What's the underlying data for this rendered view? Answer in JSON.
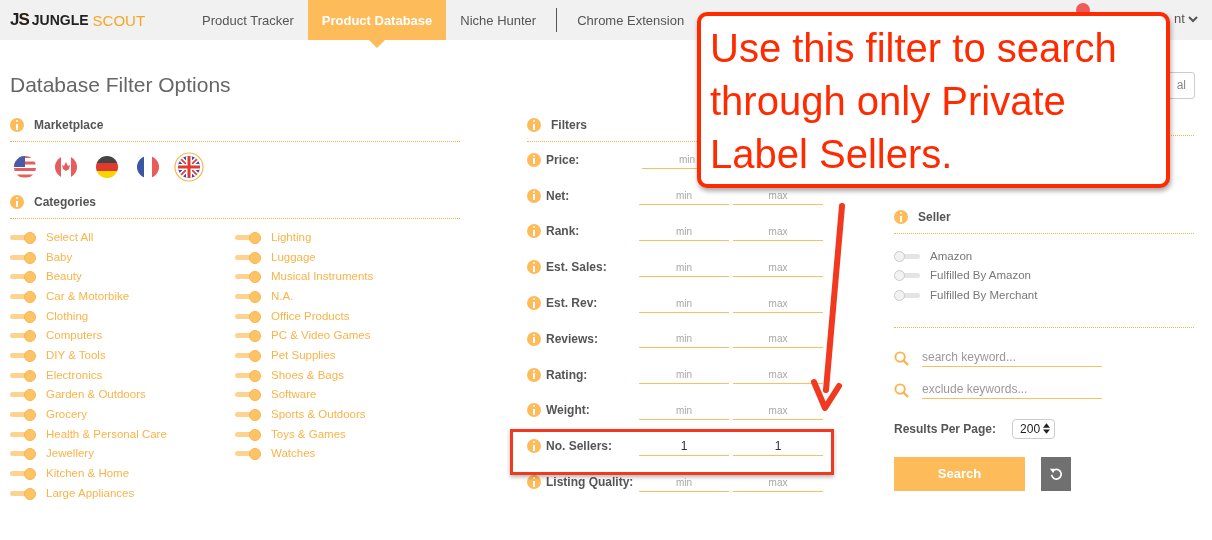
{
  "header": {
    "logo_mark": "JS",
    "logo_word_1": "JUNGLE",
    "logo_word_2": "SCOUT",
    "nav": [
      {
        "label": "Product Tracker",
        "selected": false
      },
      {
        "label": "Product Database",
        "selected": true
      },
      {
        "label": "Niche Hunter",
        "selected": false
      },
      {
        "label": "Chrome Extension",
        "selected": false
      }
    ],
    "account_partial": "nt"
  },
  "title": "Database Filter Options",
  "top_button_partial": "al",
  "marketplace": {
    "title": "Marketplace",
    "flags": [
      {
        "kind": "us",
        "selected": false
      },
      {
        "kind": "ca",
        "selected": false
      },
      {
        "kind": "de",
        "selected": false
      },
      {
        "kind": "fr",
        "selected": false
      },
      {
        "kind": "gb",
        "selected": true
      }
    ]
  },
  "categories": {
    "title": "Categories",
    "items": [
      {
        "label": "Select All",
        "on": true
      },
      {
        "label": "Baby",
        "on": true
      },
      {
        "label": "Beauty",
        "on": true
      },
      {
        "label": "Car & Motorbike",
        "on": true
      },
      {
        "label": "Clothing",
        "on": true
      },
      {
        "label": "Computers",
        "on": true
      },
      {
        "label": "DIY & Tools",
        "on": true
      },
      {
        "label": "Electronics",
        "on": true
      },
      {
        "label": "Garden & Outdoors",
        "on": true
      },
      {
        "label": "Grocery",
        "on": true
      },
      {
        "label": "Health & Personal Care",
        "on": true
      },
      {
        "label": "Jewellery",
        "on": true
      },
      {
        "label": "Kitchen & Home",
        "on": true
      },
      {
        "label": "Large Appliances",
        "on": true
      },
      {
        "label": "Lighting",
        "on": true
      },
      {
        "label": "Luggage",
        "on": true
      },
      {
        "label": "Musical Instruments",
        "on": true
      },
      {
        "label": "N.A.",
        "on": true
      },
      {
        "label": "Office Products",
        "on": true
      },
      {
        "label": "PC & Video Games",
        "on": true
      },
      {
        "label": "Pet Supplies",
        "on": true
      },
      {
        "label": "Shoes & Bags",
        "on": true
      },
      {
        "label": "Software",
        "on": true
      },
      {
        "label": "Sports & Outdoors",
        "on": true
      },
      {
        "label": "Toys & Games",
        "on": true
      },
      {
        "label": "Watches",
        "on": true
      }
    ]
  },
  "filters": {
    "title": "Filters",
    "rows": [
      {
        "label": "Price:",
        "min": {
          "placeholder": "min"
        }
      },
      {
        "label": "Net:",
        "min": {
          "placeholder": "min"
        },
        "max": {
          "placeholder": "max"
        }
      },
      {
        "label": "Rank:",
        "min": {
          "placeholder": "min"
        },
        "max": {
          "placeholder": "max"
        }
      },
      {
        "label": "Est. Sales:",
        "min": {
          "placeholder": "min"
        },
        "max": {
          "placeholder": "max"
        }
      },
      {
        "label": "Est. Rev:",
        "min": {
          "placeholder": "min"
        },
        "max": {
          "placeholder": "max"
        }
      },
      {
        "label": "Reviews:",
        "min": {
          "placeholder": "min"
        },
        "max": {
          "placeholder": "max"
        }
      },
      {
        "label": "Rating:",
        "min": {
          "placeholder": "min"
        },
        "max": {
          "placeholder": "max"
        }
      },
      {
        "label": "Weight:",
        "min": {
          "placeholder": "min"
        },
        "max": {
          "placeholder": "max"
        }
      },
      {
        "label": "No. Sellers:",
        "min": {
          "value": "1"
        },
        "max": {
          "value": "1"
        }
      },
      {
        "label": "Listing Quality:",
        "min": {
          "placeholder": "min"
        },
        "max": {
          "placeholder": "max"
        }
      }
    ]
  },
  "seller": {
    "title": "Seller",
    "options": [
      {
        "label": "Amazon",
        "on": false
      },
      {
        "label": "Fulfilled By Amazon",
        "on": false
      },
      {
        "label": "Fulfilled By Merchant",
        "on": false
      }
    ]
  },
  "keywords": [
    {
      "placeholder": "search keyword..."
    },
    {
      "placeholder": "exclude keywords..."
    }
  ],
  "results_per_page": {
    "label": "Results Per Page:",
    "value": "200"
  },
  "search_button": "Search",
  "callout": {
    "text": "Use this filter to search through only Private Label Sellers."
  }
}
